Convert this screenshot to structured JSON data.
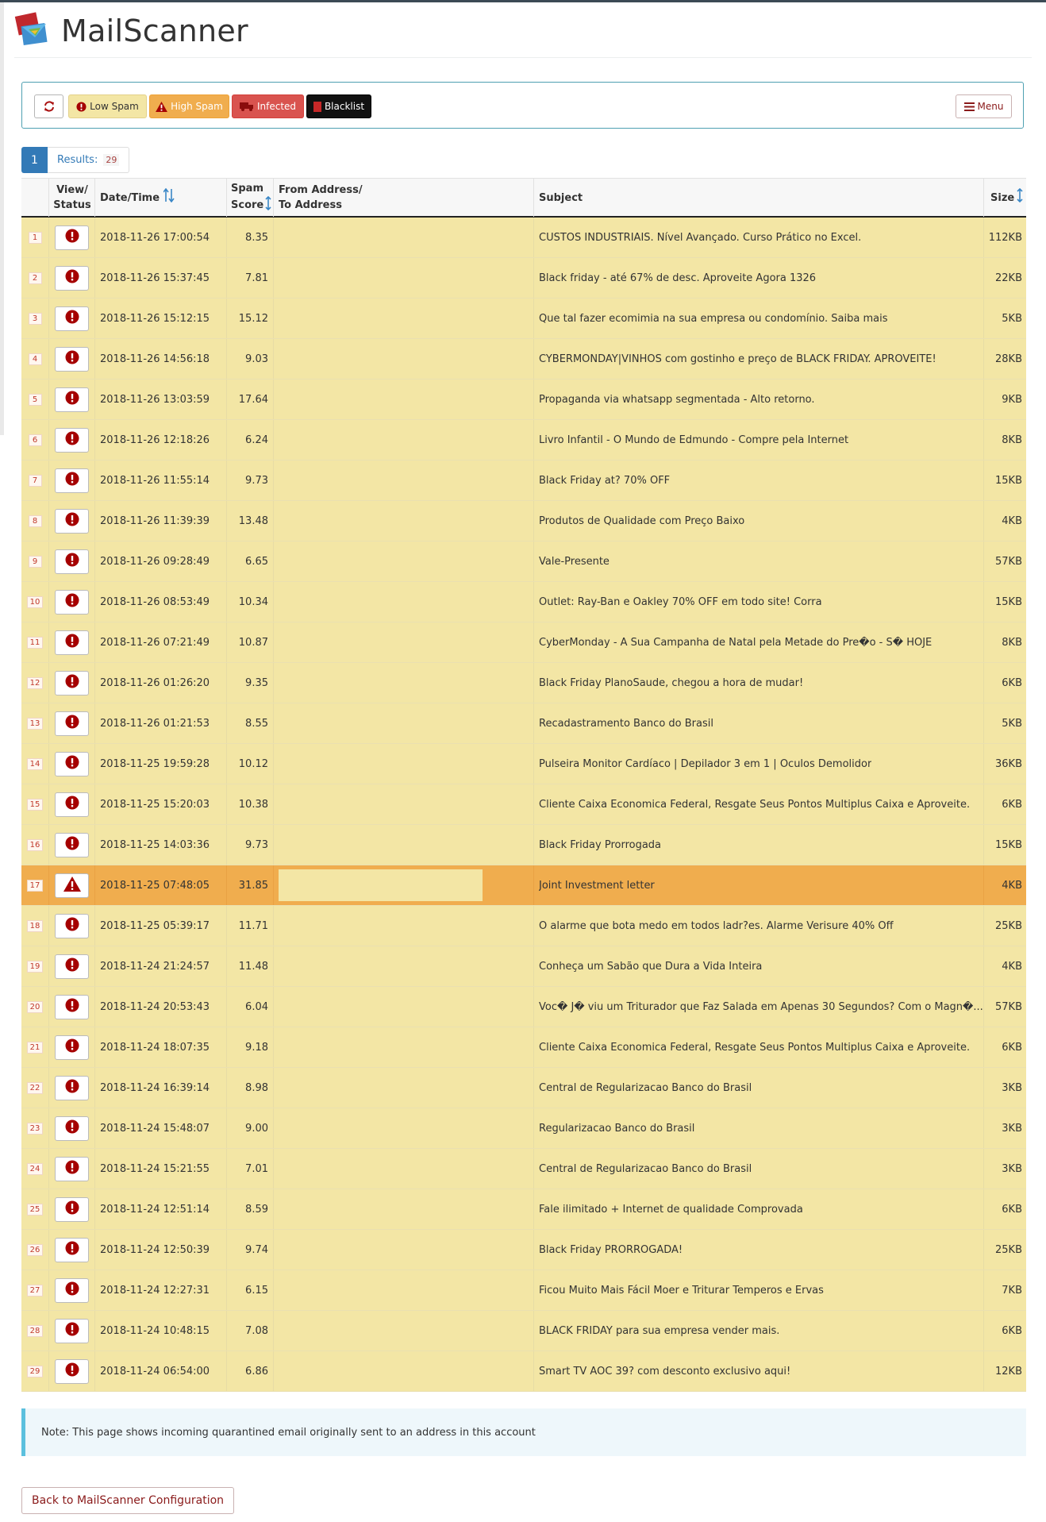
{
  "app": {
    "title": "MailScanner"
  },
  "toolbar": {
    "refresh_icon": "refresh-icon",
    "low_spam_label": "Low Spam",
    "high_spam_label": "High Spam",
    "infected_label": "Infected",
    "blacklist_label": "Blacklist",
    "menu_label": "Menu",
    "colors": {
      "low_spam": "#f3e6a5",
      "high_spam": "#f0ad4e",
      "infected": "#d9534f",
      "blacklist": "#111111"
    }
  },
  "pagination": {
    "current_page": "1",
    "results_label": "Results:",
    "results_count": "29"
  },
  "table": {
    "headers": {
      "view_status_1": "View/",
      "view_status_2": "Status",
      "datetime": "Date/Time",
      "spam_score_1": "Spam",
      "spam_score_2": "Score",
      "from_to_1": "From Address/",
      "from_to_2": "To Address",
      "subject": "Subject",
      "size": "Size"
    },
    "rows": [
      {
        "n": "1",
        "status": "low-spam",
        "date": "2018-11-26 17:00:54",
        "score": "8.35",
        "subject": "CUSTOS INDUSTRIAIS. Nível Avançado. Curso Prático no Excel.",
        "size": "112KB"
      },
      {
        "n": "2",
        "status": "low-spam",
        "date": "2018-11-26 15:37:45",
        "score": "7.81",
        "subject": "Black friday - até 67% de desc. Aproveite Agora 1326",
        "size": "22KB"
      },
      {
        "n": "3",
        "status": "low-spam",
        "date": "2018-11-26 15:12:15",
        "score": "15.12",
        "subject": "Que tal fazer ecomimia na sua empresa ou condomínio. Saiba mais",
        "size": "5KB"
      },
      {
        "n": "4",
        "status": "low-spam",
        "date": "2018-11-26 14:56:18",
        "score": "9.03",
        "subject": "CYBERMONDAY|VINHOS com gostinho e preço de BLACK FRIDAY. APROVEITE!",
        "size": "28KB"
      },
      {
        "n": "5",
        "status": "low-spam",
        "date": "2018-11-26 13:03:59",
        "score": "17.64",
        "subject": "Propaganda via whatsapp segmentada - Alto retorno.",
        "size": "9KB"
      },
      {
        "n": "6",
        "status": "low-spam",
        "date": "2018-11-26 12:18:26",
        "score": "6.24",
        "subject": "Livro Infantil - O Mundo de Edmundo - Compre pela Internet",
        "size": "8KB"
      },
      {
        "n": "7",
        "status": "low-spam",
        "date": "2018-11-26 11:55:14",
        "score": "9.73",
        "subject": "Black Friday at? 70% OFF",
        "size": "15KB"
      },
      {
        "n": "8",
        "status": "low-spam",
        "date": "2018-11-26 11:39:39",
        "score": "13.48",
        "subject": "Produtos de Qualidade com Preço Baixo",
        "size": "4KB"
      },
      {
        "n": "9",
        "status": "low-spam",
        "date": "2018-11-26 09:28:49",
        "score": "6.65",
        "subject": "Vale-Presente",
        "size": "57KB"
      },
      {
        "n": "10",
        "status": "low-spam",
        "date": "2018-11-26 08:53:49",
        "score": "10.34",
        "subject": "Outlet: Ray-Ban e Oakley 70% OFF em todo site! Corra",
        "size": "15KB"
      },
      {
        "n": "11",
        "status": "low-spam",
        "date": "2018-11-26 07:21:49",
        "score": "10.87",
        "subject": "CyberMonday - A Sua Campanha de Natal pela Metade do Pre�o - S� HOJE",
        "size": "8KB"
      },
      {
        "n": "12",
        "status": "low-spam",
        "date": "2018-11-26 01:26:20",
        "score": "9.35",
        "subject": "Black Friday PlanoSaude, chegou a hora de mudar!",
        "size": "6KB"
      },
      {
        "n": "13",
        "status": "low-spam",
        "date": "2018-11-26 01:21:53",
        "score": "8.55",
        "subject": "Recadastramento Banco do Brasil",
        "size": "5KB"
      },
      {
        "n": "14",
        "status": "low-spam",
        "date": "2018-11-25 19:59:28",
        "score": "10.12",
        "subject": "Pulseira Monitor Cardíaco | Depilador 3 em 1 | Óculos Demolidor",
        "size": "36KB"
      },
      {
        "n": "15",
        "status": "low-spam",
        "date": "2018-11-25 15:20:03",
        "score": "10.38",
        "subject": "Cliente Caixa Economica Federal, Resgate Seus Pontos Multiplus Caixa e Aproveite.",
        "size": "6KB"
      },
      {
        "n": "16",
        "status": "low-spam",
        "date": "2018-11-25 14:03:36",
        "score": "9.73",
        "subject": "Black Friday Prorrogada",
        "size": "15KB"
      },
      {
        "n": "17",
        "status": "high-spam",
        "date": "2018-11-25 07:48:05",
        "score": "31.85",
        "subject": "Joint Investment letter",
        "size": "4KB"
      },
      {
        "n": "18",
        "status": "low-spam",
        "date": "2018-11-25 05:39:17",
        "score": "11.71",
        "subject": "O alarme que bota medo em todos ladr?es. Alarme Verisure 40% Off",
        "size": "25KB"
      },
      {
        "n": "19",
        "status": "low-spam",
        "date": "2018-11-24 21:24:57",
        "score": "11.48",
        "subject": "Conheça um Sabão que Dura a Vida Inteira",
        "size": "4KB"
      },
      {
        "n": "20",
        "status": "low-spam",
        "date": "2018-11-24 20:53:43",
        "score": "6.04",
        "subject": "Voc� J� viu um Triturador que Faz Salada em Apenas 30 Segundos? Com o Magn�...",
        "size": "57KB"
      },
      {
        "n": "21",
        "status": "low-spam",
        "date": "2018-11-24 18:07:35",
        "score": "9.18",
        "subject": "Cliente Caixa Economica Federal, Resgate Seus Pontos Multiplus Caixa e Aproveite.",
        "size": "6KB"
      },
      {
        "n": "22",
        "status": "low-spam",
        "date": "2018-11-24 16:39:14",
        "score": "8.98",
        "subject": "Central de Regularizacao Banco do Brasil",
        "size": "3KB"
      },
      {
        "n": "23",
        "status": "low-spam",
        "date": "2018-11-24 15:48:07",
        "score": "9.00",
        "subject": "Regularizacao Banco do Brasil",
        "size": "3KB"
      },
      {
        "n": "24",
        "status": "low-spam",
        "date": "2018-11-24 15:21:55",
        "score": "7.01",
        "subject": "Central de Regularizacao Banco do Brasil",
        "size": "3KB"
      },
      {
        "n": "25",
        "status": "low-spam",
        "date": "2018-11-24 12:51:14",
        "score": "8.59",
        "subject": "Fale ilimitado + Internet de qualidade Comprovada",
        "size": "6KB"
      },
      {
        "n": "26",
        "status": "low-spam",
        "date": "2018-11-24 12:50:39",
        "score": "9.74",
        "subject": "Black Friday PRORROGADA!",
        "size": "25KB"
      },
      {
        "n": "27",
        "status": "low-spam",
        "date": "2018-11-24 12:27:31",
        "score": "6.15",
        "subject": "Ficou Muito Mais Fácil Moer e Triturar Temperos e Ervas",
        "size": "7KB"
      },
      {
        "n": "28",
        "status": "low-spam",
        "date": "2018-11-24 10:48:15",
        "score": "7.08",
        "subject": "BLACK FRIDAY para sua empresa vender mais.",
        "size": "6KB"
      },
      {
        "n": "29",
        "status": "low-spam",
        "date": "2018-11-24 06:54:00",
        "score": "6.86",
        "subject": "Smart TV AOC 39? com desconto exclusivo aqui!",
        "size": "12KB"
      }
    ]
  },
  "note": {
    "text": "Note: This page shows incoming quarantined email originally sent to an address in this account"
  },
  "footer": {
    "back_label": "Back to MailScanner Configuration"
  }
}
